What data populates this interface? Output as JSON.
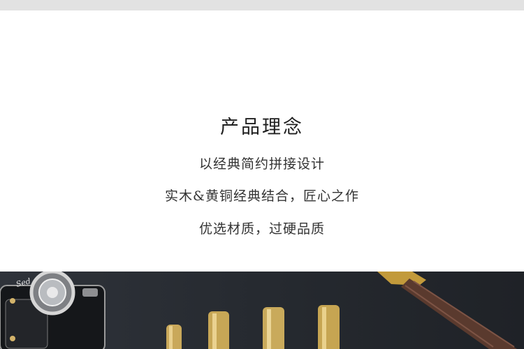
{
  "section": {
    "title": "产品理念",
    "lines": [
      "以经典简约拼接设计",
      "实木&黄铜经典结合，匠心之作",
      "优选材质，过硬品质"
    ]
  },
  "photo": {
    "camera_badge_text": "Sed",
    "colors": {
      "background": "#2a2e34",
      "brass": "#c9a85a",
      "leather": "#5a3a2e"
    }
  }
}
